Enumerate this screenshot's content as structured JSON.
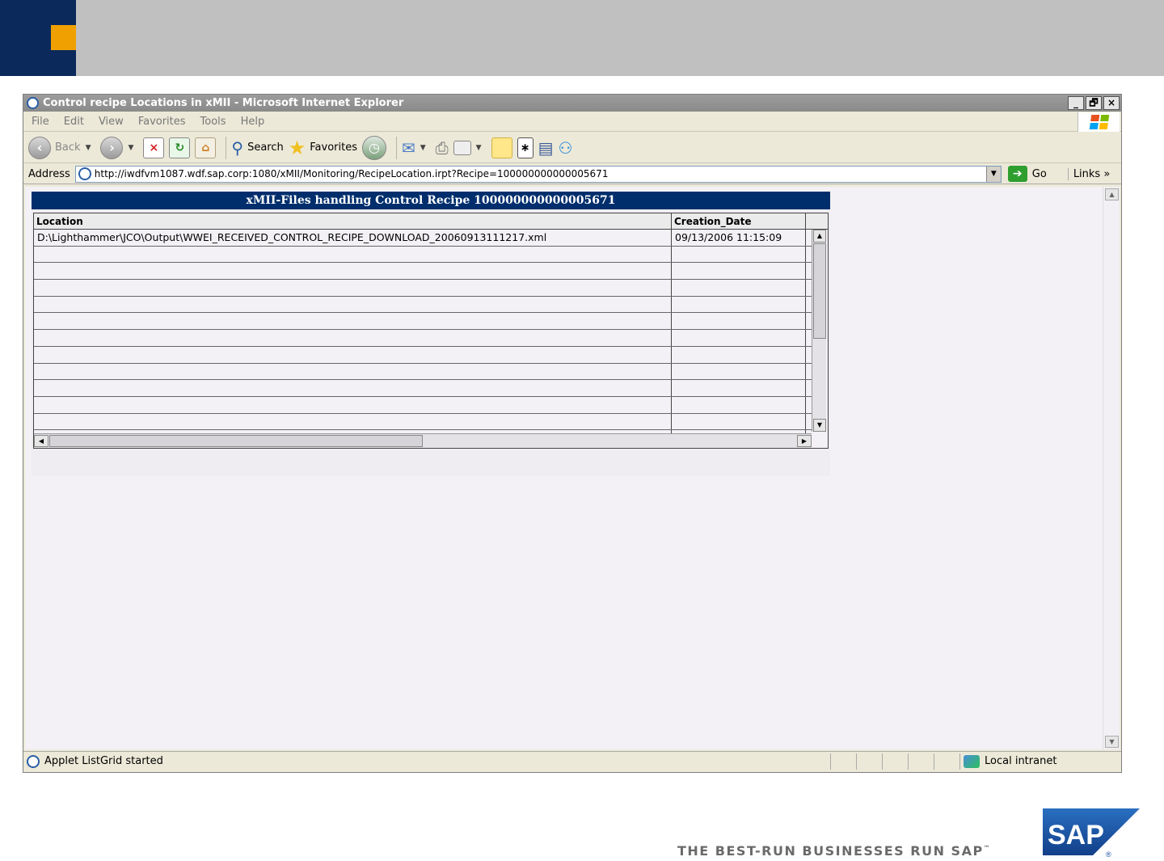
{
  "slide": {
    "tagline": "THE BEST-RUN BUSINESSES RUN SAP",
    "tagline_tm": "™",
    "logo_text": "SAP",
    "logo_registered": "®",
    "colors": {
      "header_gray": "#c0c0c0",
      "navy": "#0b2a5b",
      "orange": "#f0a000",
      "sap_blue": "#1a4fa0"
    }
  },
  "browser": {
    "title": "Control recipe Locations in xMII - Microsoft Internet Explorer",
    "window_buttons": [
      "_",
      "🗗",
      "×"
    ],
    "menu": [
      "File",
      "Edit",
      "View",
      "Favorites",
      "Tools",
      "Help"
    ],
    "toolbar": {
      "back_label": "Back",
      "search_label": "Search",
      "favorites_label": "Favorites"
    },
    "address": {
      "label": "Address",
      "url": "http://iwdfvm1087.wdf.sap.corp:1080/xMII/Monitoring/RecipeLocation.irpt?Recipe=100000000000005671",
      "go_label": "Go",
      "links_label": "Links",
      "links_chevron": "»"
    },
    "status": {
      "text": "Applet ListGrid started",
      "zone": "Local intranet"
    }
  },
  "applet": {
    "title": "xMII-Files handling Control Recipe 100000000000005671",
    "columns": [
      "Location",
      "Creation_Date"
    ],
    "rows": [
      [
        "D:\\Lighthammer\\JCO\\Output\\WWEI_RECEIVED_CONTROL_RECIPE_DOWNLOAD_20060913111217.xml",
        "09/13/2006 11:15:09"
      ],
      [
        "",
        ""
      ],
      [
        "",
        ""
      ],
      [
        "",
        ""
      ],
      [
        "",
        ""
      ],
      [
        "",
        ""
      ],
      [
        "",
        ""
      ],
      [
        "",
        ""
      ],
      [
        "",
        ""
      ],
      [
        "",
        ""
      ],
      [
        "",
        ""
      ],
      [
        "",
        ""
      ],
      [
        "",
        ""
      ]
    ]
  }
}
